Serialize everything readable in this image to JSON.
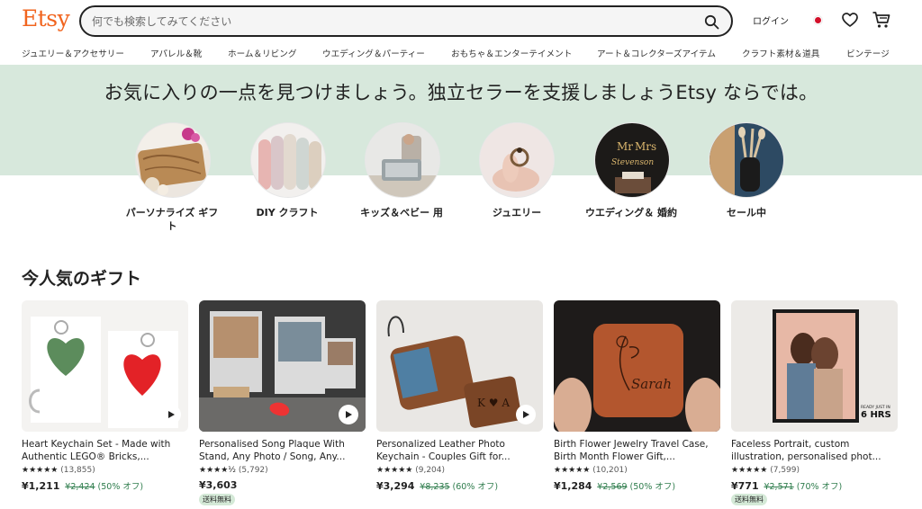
{
  "header": {
    "logo": "Etsy",
    "search_placeholder": "何でも検索してみてください",
    "login": "ログイン"
  },
  "categories": [
    "ジュエリー＆アクセサリー",
    "アパレル＆靴",
    "ホーム＆リビング",
    "ウエディング＆パーティー",
    "おもちゃ＆エンターテイメント",
    "アート＆コレクターズアイテム",
    "クラフト素材＆道具",
    "ビンテージ"
  ],
  "hero": {
    "title": "お気に入りの一点を見つけましょう。独立セラーを支援しましょうEtsy ならでは。",
    "circles": [
      {
        "label": "パーソナライズ ギフト"
      },
      {
        "label": "DIY クラフト"
      },
      {
        "label": "キッズ＆ベビー 用"
      },
      {
        "label": "ジュエリー"
      },
      {
        "label": "ウエディング＆ 婚約"
      },
      {
        "label": "セール中"
      }
    ]
  },
  "section_title": "今人気のギフト",
  "products": [
    {
      "title": "Heart Keychain Set - Made with Authentic LEGO® Bricks,...",
      "stars": "★★★★★",
      "count": "(13,855)",
      "price": "¥1,211",
      "original": "¥2,424",
      "discount": "(50% オフ)",
      "free_shipping": "",
      "rating": 5
    },
    {
      "title": "Personalised Song Plaque With Stand, Any Photo / Song, Any...",
      "stars": "★★★★½",
      "count": "(5,792)",
      "price": "¥3,603",
      "original": "",
      "discount": "",
      "free_shipping": "送料無料",
      "rating": 4.5
    },
    {
      "title": "Personalized Leather Photo Keychain - Couples Gift for...",
      "stars": "★★★★★",
      "count": "(9,204)",
      "price": "¥3,294",
      "original": "¥8,235",
      "discount": "(60% オフ)",
      "free_shipping": "",
      "rating": 5
    },
    {
      "title": "Birth Flower Jewelry Travel Case, Birth Month Flower Gift,...",
      "stars": "★★★★★",
      "count": "(10,201)",
      "price": "¥1,284",
      "original": "¥2,569",
      "discount": "(50% オフ)",
      "free_shipping": "",
      "rating": 5
    },
    {
      "title": "Faceless Portrait, custom illustration, personalised phot...",
      "stars": "★★★★★",
      "count": "(7,599)",
      "price": "¥771",
      "original": "¥2,571",
      "discount": "(70% オフ)",
      "free_shipping": "送料無料",
      "rating": 5
    }
  ],
  "image_text": {
    "jewelry_case_name": "Sarah",
    "portrait_badge": "READY JUST IN 6 HRS",
    "wedding_sign": "Mr Mrs Stevenson",
    "keychain_initials": "K ♥ A"
  },
  "colors": {
    "brand": "#f1641e",
    "hero_band": "#d7e8dc",
    "discount_green": "#2f7d4d",
    "free_shipping_badge": "#d4e9d7"
  },
  "icons": [
    "search-icon",
    "flag-icon",
    "heart-icon",
    "cart-icon",
    "play-icon"
  ]
}
